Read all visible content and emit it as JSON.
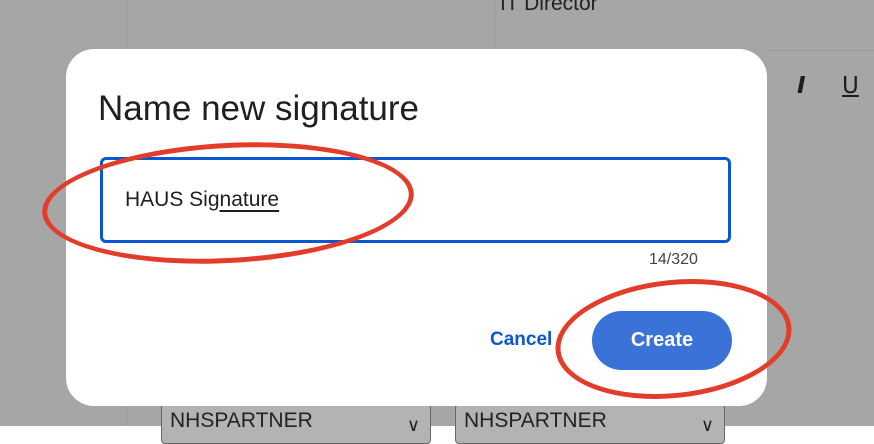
{
  "background": {
    "header_text": "IT Director",
    "format_italic": "I",
    "format_underline": "U",
    "select_left": "NHSPARTNER",
    "select_right": "NHSPARTNER",
    "select_chevron": "∨"
  },
  "dialog": {
    "title": "Name new signature",
    "input_value_plain": "HAUS Sig",
    "input_value_underlined": "nature",
    "char_counter": "14/320",
    "cancel_label": "Cancel",
    "create_label": "Create"
  },
  "colors": {
    "accent": "#0b57d0",
    "create_button": "#3a72d8",
    "annotation": "#e43c2a",
    "overlay": "#a6a6a6"
  }
}
